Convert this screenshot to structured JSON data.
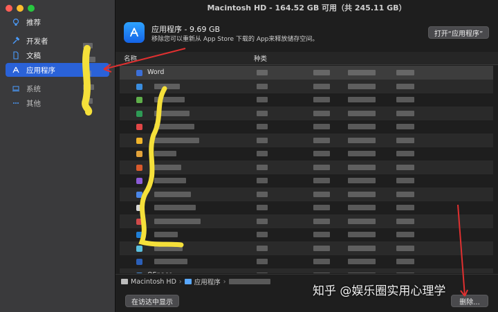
{
  "window": {
    "title": "Macintosh HD - 164.52 GB 可用（共 245.11 GB）"
  },
  "sidebar": {
    "items": [
      {
        "label": "推荐",
        "icon": "lightbulb-icon"
      },
      {
        "label": "开发者",
        "icon": "hammer-icon"
      },
      {
        "label": "文稿",
        "icon": "document-icon"
      },
      {
        "label": "应用程序",
        "icon": "app-store-icon",
        "active": true
      },
      {
        "label": "系统",
        "icon": "laptop-icon"
      },
      {
        "label": "其他",
        "icon": "ellipsis-icon"
      }
    ]
  },
  "header": {
    "title": "应用程序 - 9.69 GB",
    "subtitle": "移除您可以重新从 App Store 下载的 App来释放储存空间。",
    "open_button": "打开“应用程序”"
  },
  "table": {
    "columns": [
      "名称",
      "种类"
    ],
    "rows": [
      {
        "name": "Word",
        "color": "#3b6fd8"
      },
      {
        "name": "",
        "color": "#3a8dde"
      },
      {
        "name": "",
        "color": "#5fae4a"
      },
      {
        "name": "",
        "color": "#2e9a55"
      },
      {
        "name": "",
        "color": "#e04646"
      },
      {
        "name": "",
        "color": "#f0b42a"
      },
      {
        "name": "",
        "color": "#e2a23a"
      },
      {
        "name": "",
        "color": "#d95a2c"
      },
      {
        "name": "",
        "color": "#8c5bd6"
      },
      {
        "name": "",
        "color": "#4a86e8"
      },
      {
        "name": "",
        "color": "#d8d8d8"
      },
      {
        "name": "",
        "color": "#d04a4a"
      },
      {
        "name": "",
        "color": "#1f7fd6"
      },
      {
        "name": "",
        "color": "#5bc0de"
      },
      {
        "name": "",
        "color": "#2b5fb8"
      },
      {
        "name": "QSpace",
        "color": "#4a90d9"
      }
    ]
  },
  "footer": {
    "path": [
      "Macintosh HD",
      "应用程序"
    ],
    "finder_button": "在访达中显示",
    "delete_button": "删除..."
  },
  "watermark": "知乎 @娱乐圈实用心理学",
  "colors": {
    "accent": "#2a62d8",
    "annotation": "#f5e03a",
    "arrow": "#e03030"
  }
}
